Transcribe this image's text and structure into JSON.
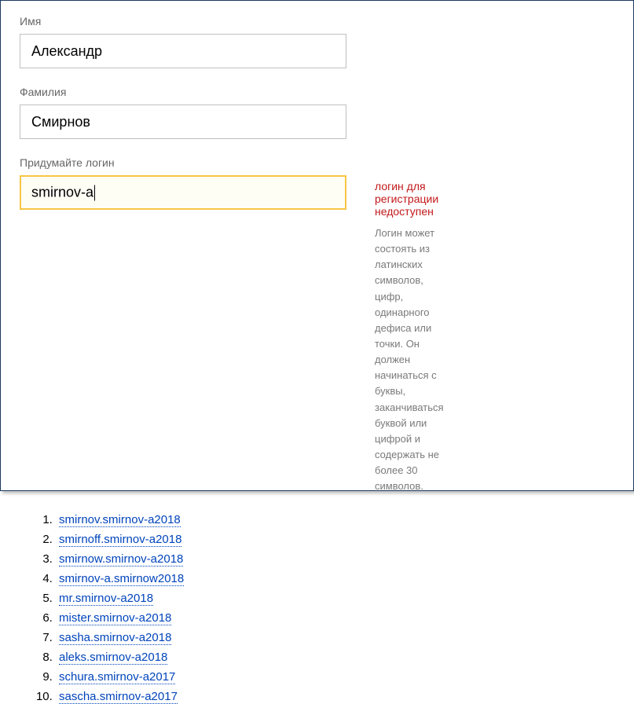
{
  "fields": {
    "firstName": {
      "label": "Имя",
      "value": "Александр"
    },
    "lastName": {
      "label": "Фамилия",
      "value": "Смирнов"
    },
    "login": {
      "label": "Придумайте логин",
      "value": "smirnov-a"
    }
  },
  "validation": {
    "errorMessage": "логин для регистрации недоступен",
    "hint": "Логин может состоять из латинских символов, цифр, одинарного дефиса или точки. Он должен начинаться с буквы, заканчиваться буквой или цифрой и содержать не более 30 символов."
  },
  "suggestions": [
    "smirnov.smirnov-a2018",
    "smirnoff.smirnov-a2018",
    "smirnow.smirnov-a2018",
    "smirnov-a.smirnow2018",
    "mr.smirnov-a2018",
    "mister.smirnov-a2018",
    "sasha.smirnov-a2018",
    "aleks.smirnov-a2018",
    "schura.smirnov-a2017",
    "sascha.smirnov-a2017"
  ]
}
